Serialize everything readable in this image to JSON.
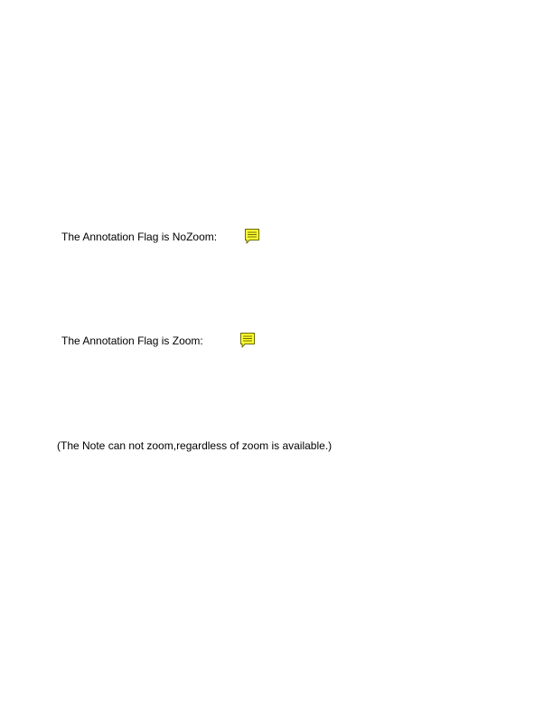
{
  "document": {
    "lines": [
      {
        "text": "The Annotation Flag is NoZoom:",
        "note_icon": "comment-note-icon"
      },
      {
        "text": "The Annotation Flag is Zoom:",
        "note_icon": "comment-note-icon"
      },
      {
        "text": "(The Note can not zoom,regardless of zoom is available.)"
      }
    ]
  },
  "colors": {
    "page_background": "#ffffff",
    "text": "#000000",
    "note_fill": "#ffff33",
    "note_stroke": "#6b6b00"
  }
}
